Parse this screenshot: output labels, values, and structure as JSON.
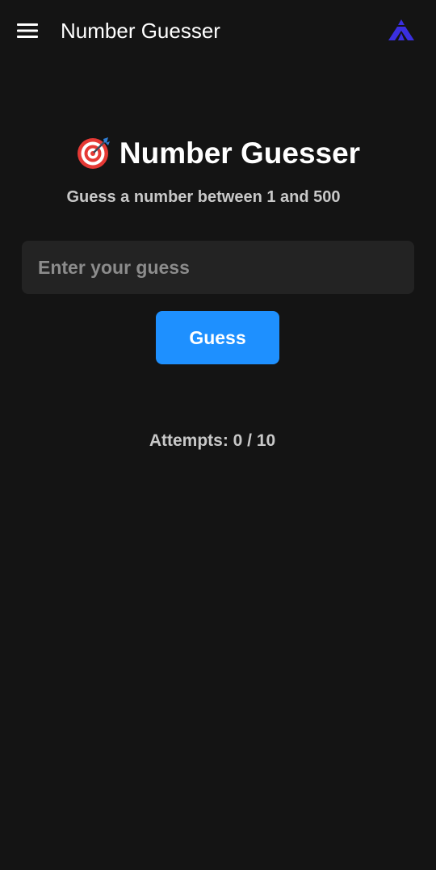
{
  "app_bar": {
    "title": "Number Guesser",
    "menu_icon": "hamburger-menu-icon",
    "brand_icon": "mountain-logo-icon"
  },
  "main": {
    "headline_icon": "direct-hit-target-icon",
    "headline": "Number Guesser",
    "subtitle": "Guess a number between 1 and 500",
    "input": {
      "value": "",
      "placeholder": "Enter your guess"
    },
    "guess_button_label": "Guess",
    "attempts_text": "Attempts: 0 / 10"
  },
  "colors": {
    "background": "#141414",
    "input_background": "#232323",
    "primary_button": "#1e90ff",
    "brand_logo": "#3a2fe0",
    "target_red": "#e53935"
  }
}
